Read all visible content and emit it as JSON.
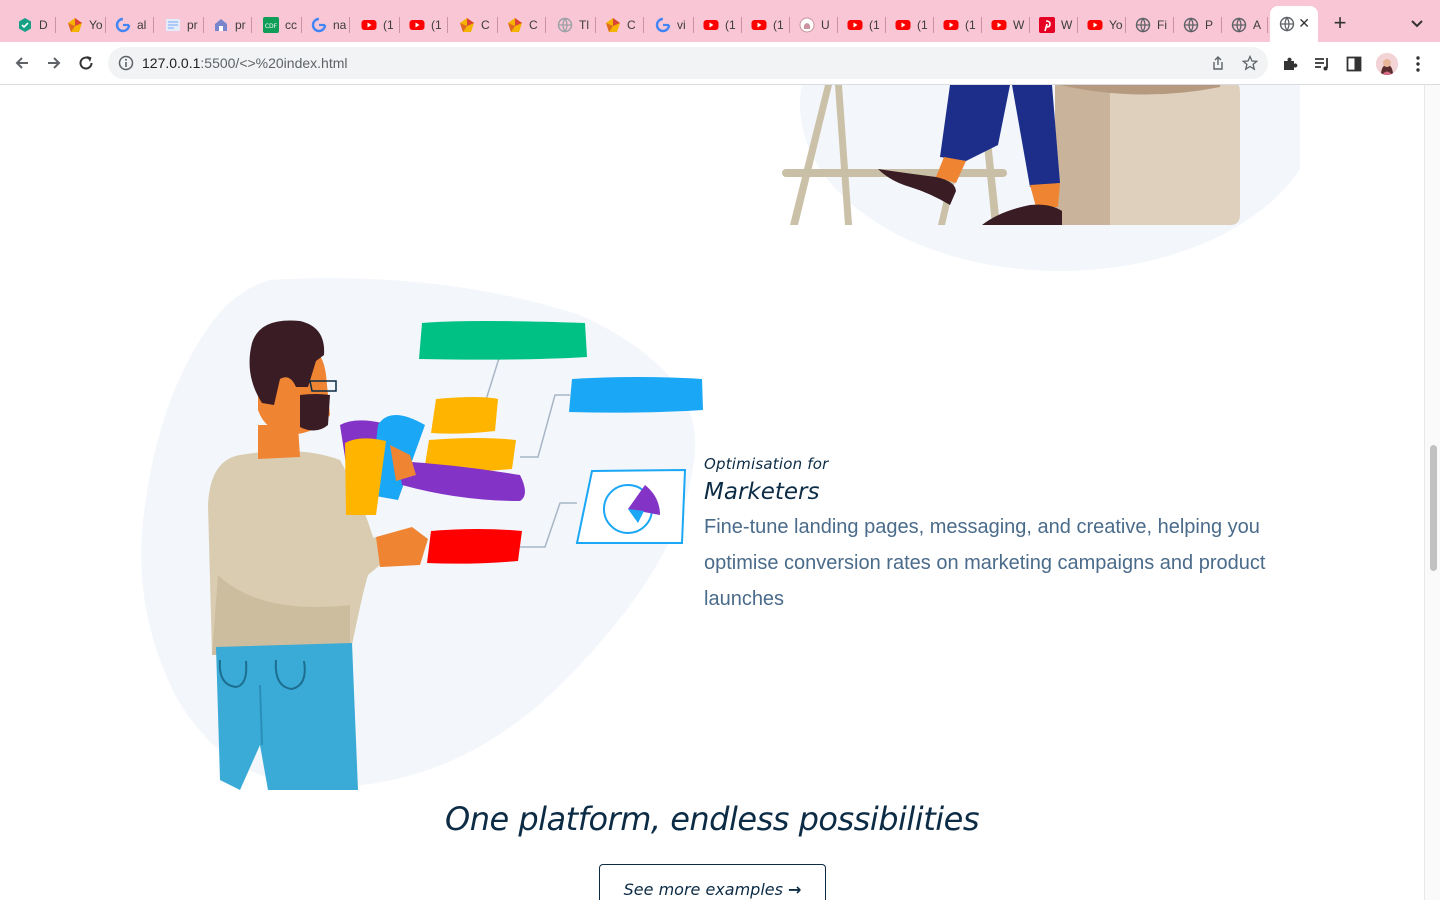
{
  "browser": {
    "tabs": [
      {
        "label": "D",
        "icon": "hex-app-icon",
        "color": "#16a085"
      },
      {
        "label": "Yo",
        "icon": "colorful-app-icon",
        "color": "#f4b400"
      },
      {
        "label": "al",
        "icon": "google-icon",
        "color": "#4285f4"
      },
      {
        "label": "pr",
        "icon": "doc-thumb-icon",
        "color": "#8ab4f8"
      },
      {
        "label": "pr",
        "icon": "site-icon",
        "color": "#7986cb"
      },
      {
        "label": "cc",
        "icon": "cdf-icon",
        "color": "#0f9d58"
      },
      {
        "label": "na",
        "icon": "google-icon",
        "color": "#4285f4"
      },
      {
        "label": "(1",
        "icon": "youtube-icon",
        "color": "#ff0000"
      },
      {
        "label": "(1",
        "icon": "youtube-icon",
        "color": "#ff0000"
      },
      {
        "label": "C",
        "icon": "colorful-app-icon",
        "color": "#f4b400"
      },
      {
        "label": "C",
        "icon": "colorful-app-icon",
        "color": "#f4b400"
      },
      {
        "label": "Tl",
        "icon": "globe-icon",
        "color": "#9aa0a6"
      },
      {
        "label": "C",
        "icon": "colorful-app-icon",
        "color": "#f4b400"
      },
      {
        "label": "vi",
        "icon": "google-icon",
        "color": "#4285f4"
      },
      {
        "label": "(1",
        "icon": "youtube-icon",
        "color": "#ff0000"
      },
      {
        "label": "(1",
        "icon": "youtube-icon",
        "color": "#ff0000"
      },
      {
        "label": "U",
        "icon": "github-icon",
        "color": "#ffffff"
      },
      {
        "label": "(1",
        "icon": "youtube-icon",
        "color": "#ff0000"
      },
      {
        "label": "(1",
        "icon": "youtube-icon",
        "color": "#ff0000"
      },
      {
        "label": "(1",
        "icon": "youtube-icon",
        "color": "#ff0000"
      },
      {
        "label": "W",
        "icon": "youtube-icon",
        "color": "#ff0000"
      },
      {
        "label": "W",
        "icon": "pinterest-icon",
        "color": "#e60023"
      },
      {
        "label": "Yo",
        "icon": "youtube-icon",
        "color": "#ff0000"
      },
      {
        "label": "Fi",
        "icon": "globe-icon",
        "color": "#5f6368"
      },
      {
        "label": "P",
        "icon": "globe-icon",
        "color": "#5f6368"
      },
      {
        "label": "A",
        "icon": "globe-icon",
        "color": "#5f6368"
      },
      {
        "label": "",
        "icon": "globe-icon",
        "color": "#5f6368",
        "active": true
      }
    ],
    "new_tab_label": "+",
    "url_host": "127.0.0.1",
    "url_rest": ":5500/<>%20index.html"
  },
  "content": {
    "eyebrow": "Optimisation for",
    "title": "Marketers",
    "description": "Fine-tune landing pages, messaging, and creative, helping you optimise conversion rates on marketing campaigns and product launches",
    "headline": "One platform, endless possibilities",
    "cta_label": "See more examples",
    "cta_arrow": "→"
  },
  "colors": {
    "tab_strip": "#f8c6d4",
    "heading": "#0c2b45",
    "body_text": "#4a6b8a",
    "blob": "#f3f6fb",
    "green_block": "#00c184",
    "blue_block": "#1aa7f5",
    "yellow_block": "#ffb400",
    "purple_block": "#8433c7",
    "red_block": "#ff0000"
  }
}
